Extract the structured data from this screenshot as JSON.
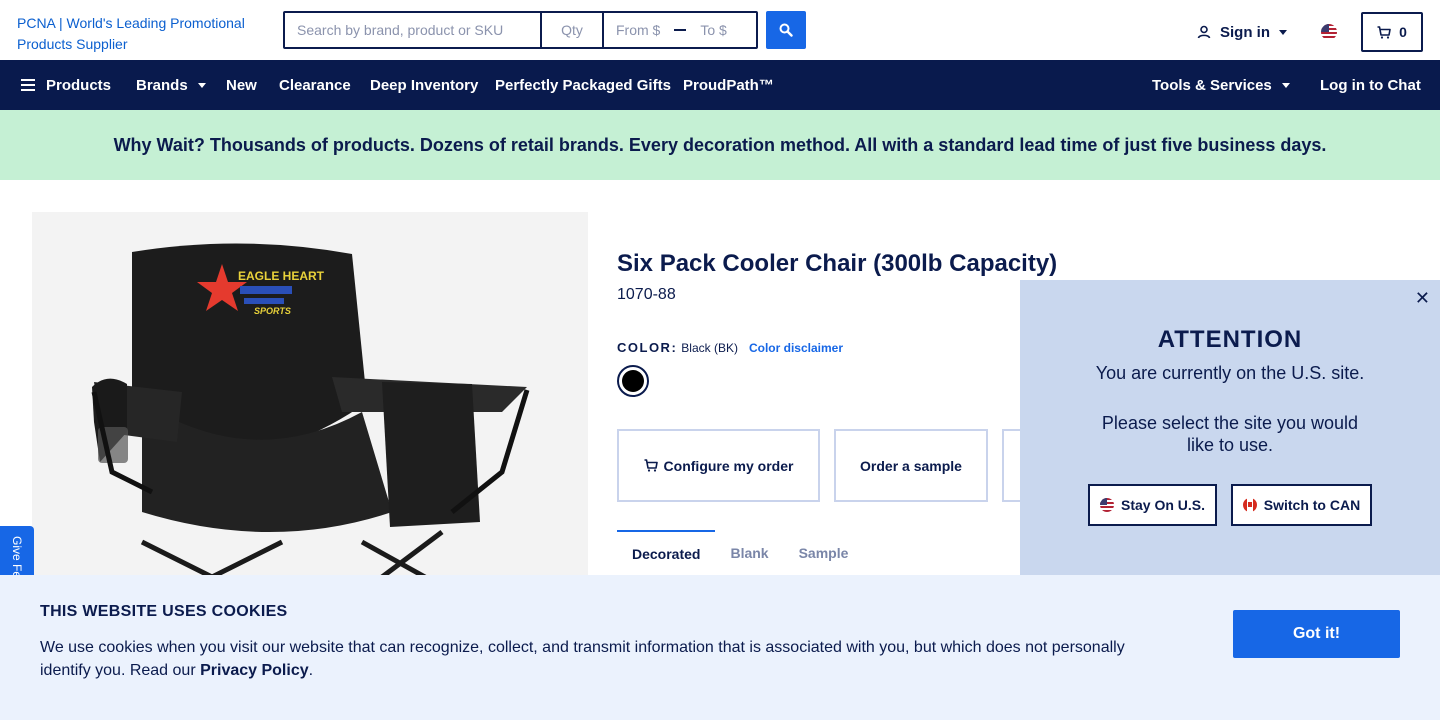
{
  "header": {
    "logo_alt": "PCNA | World's Leading Promotional Products Supplier",
    "search_placeholder": "Search by brand, product or SKU",
    "qty_placeholder": "Qty",
    "price_from_placeholder": "From $",
    "price_to_placeholder": "To $",
    "signin_label": "Sign in",
    "cart_count": "0"
  },
  "nav": {
    "items": [
      {
        "label": "Products"
      },
      {
        "label": "Brands"
      },
      {
        "label": "New"
      },
      {
        "label": "Clearance"
      },
      {
        "label": "Deep Inventory"
      },
      {
        "label": "Perfectly Packaged Gifts"
      },
      {
        "label": "ProudPath™"
      },
      {
        "label": "Tools & Services"
      },
      {
        "label": "Log in to Chat"
      }
    ]
  },
  "promo": {
    "text": "Why Wait? Thousands of products. Dozens of retail brands. Every decoration method. All with a standard lead time of just five business days."
  },
  "product": {
    "image_print_brand": "EAGLE HEART",
    "image_print_sub": "SPORTS",
    "title": "Six Pack Cooler Chair (300lb Capacity)",
    "sku": "1070-88",
    "color_label": "COLOR:",
    "color_value": "Black (BK)",
    "color_disclaimer": "Color disclaimer",
    "swatch_color": "#000000",
    "actions": [
      {
        "label": "Configure my order"
      },
      {
        "label": "Order a sample"
      }
    ],
    "tabs": [
      {
        "label": "Decorated",
        "active": true
      },
      {
        "label": "Blank",
        "active": false
      },
      {
        "label": "Sample",
        "active": false
      }
    ]
  },
  "region_modal": {
    "close_glyph": "✕",
    "heading": "ATTENTION",
    "line1": "You are currently on the U.S. site.",
    "line2": "Please select the site you would like to use.",
    "stay_label": "Stay On U.S.",
    "switch_label": "Switch to CAN"
  },
  "feedback": {
    "label": "Give Feedback"
  },
  "cookie": {
    "heading": "THIS WEBSITE USES COOKIES",
    "text_before": "We use cookies when you visit our website that can recognize, collect, and transmit information that is associated with you, but which does not personally identify you. Read our ",
    "link": "Privacy Policy",
    "text_after": ".",
    "button": "Got it!"
  },
  "colors": {
    "navy": "#091a4d",
    "accent_blue": "#1767e6",
    "promo_green": "#c5f0d4",
    "modal_bg": "#c9d7ee",
    "cookie_bg": "#ebf2fd"
  },
  "icons": {
    "search": "search-icon",
    "user": "user-icon",
    "cart": "cart-icon",
    "menu": "hamburger-icon",
    "close": "close-icon"
  }
}
